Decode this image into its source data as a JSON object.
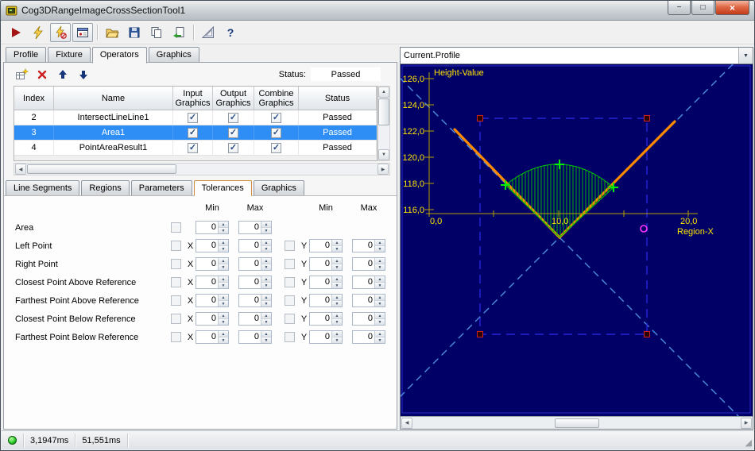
{
  "window": {
    "title": "Cog3DRangeImageCrossSectionTool1",
    "minimize_glyph": "−",
    "maximize_glyph": "□",
    "close_glyph": "×"
  },
  "toolbar": {
    "help_glyph": "?"
  },
  "tabs": {
    "profile": "Profile",
    "fixture": "Fixture",
    "operators": "Operators",
    "graphics": "Graphics"
  },
  "operators_page": {
    "status_label": "Status:",
    "status_value": "Passed",
    "table": {
      "headers": {
        "index": "Index",
        "name": "Name",
        "input": "Input Graphics",
        "output": "Output Graphics",
        "combine": "Combine Graphics",
        "status": "Status"
      },
      "rows": [
        {
          "index": "2",
          "name": "IntersectLineLine1",
          "input_checked": true,
          "output_checked": true,
          "combine_checked": true,
          "status": "Passed",
          "selected": false
        },
        {
          "index": "3",
          "name": "Area1",
          "input_checked": true,
          "output_checked": true,
          "combine_checked": true,
          "status": "Passed",
          "selected": true
        },
        {
          "index": "4",
          "name": "PointAreaResult1",
          "input_checked": true,
          "output_checked": true,
          "combine_checked": true,
          "status": "Passed",
          "selected": false
        }
      ]
    }
  },
  "sub_tabs": {
    "line_segments": "Line Segments",
    "regions": "Regions",
    "parameters": "Parameters",
    "tolerances": "Tolerances",
    "graphics": "Graphics"
  },
  "tolerances": {
    "headers": [
      "Min",
      "Max",
      "Min",
      "Max"
    ],
    "x_label": "X",
    "y_label": "Y",
    "rows": [
      {
        "label": "Area",
        "has_xy": false,
        "values": [
          "0",
          "0"
        ]
      },
      {
        "label": "Left Point",
        "has_xy": true,
        "values": [
          "0",
          "0",
          "0",
          "0"
        ]
      },
      {
        "label": "Right Point",
        "has_xy": true,
        "values": [
          "0",
          "0",
          "0",
          "0"
        ]
      },
      {
        "label": "Closest Point Above Reference",
        "has_xy": true,
        "values": [
          "0",
          "0",
          "0",
          "0"
        ]
      },
      {
        "label": "Farthest Point Above Reference",
        "has_xy": true,
        "values": [
          "0",
          "0",
          "0",
          "0"
        ]
      },
      {
        "label": "Closest Point Below Reference",
        "has_xy": true,
        "values": [
          "0",
          "0",
          "0",
          "0"
        ]
      },
      {
        "label": "Farthest Point Below Reference",
        "has_xy": true,
        "values": [
          "0",
          "0",
          "0",
          "0"
        ]
      }
    ]
  },
  "profile_panel": {
    "selector_value": "Current.Profile",
    "chart_data": {
      "type": "line",
      "ylabel": "Height-Value",
      "xlabel": "Region-X",
      "ylim": [
        116,
        126
      ],
      "xlim": [
        0,
        20
      ],
      "yticks": [
        "126,0",
        "124,0",
        "122,0",
        "120,0",
        "118,0",
        "116,0"
      ],
      "xticks": [
        "0,0",
        "10,0",
        "20,0"
      ],
      "series": [
        {
          "name": "profile-line",
          "color": "#ff8a00",
          "points": [
            [
              2.0,
              122.1
            ],
            [
              10.1,
              113.9
            ],
            [
              19.0,
              122.7
            ]
          ]
        },
        {
          "name": "cross-section-area",
          "color": "#00cc00",
          "points": [
            [
              5.9,
              117.9
            ],
            [
              10.1,
              119.5
            ],
            [
              14.2,
              117.9
            ],
            [
              10.1,
              113.9
            ]
          ]
        }
      ],
      "markers": [
        {
          "name": "left-point",
          "x": 5.9,
          "y": 117.9
        },
        {
          "name": "peak-point",
          "x": 10.1,
          "y": 119.5
        },
        {
          "name": "right-point",
          "x": 14.2,
          "y": 117.9
        }
      ],
      "region_box": {
        "x0": 3.9,
        "x1": 16.8,
        "y0": 106.5,
        "y1": 123.0
      },
      "colors": {
        "plot_bg": "#000066",
        "axis_text": "#ffe400",
        "region_outline": "#2525d8",
        "dof_lines": "#4c8fe2",
        "handles": "#cc2222",
        "marker": "#00ee00"
      }
    }
  },
  "statusbar": {
    "execution_time": "3,1947ms",
    "total_time": "51,551ms"
  }
}
